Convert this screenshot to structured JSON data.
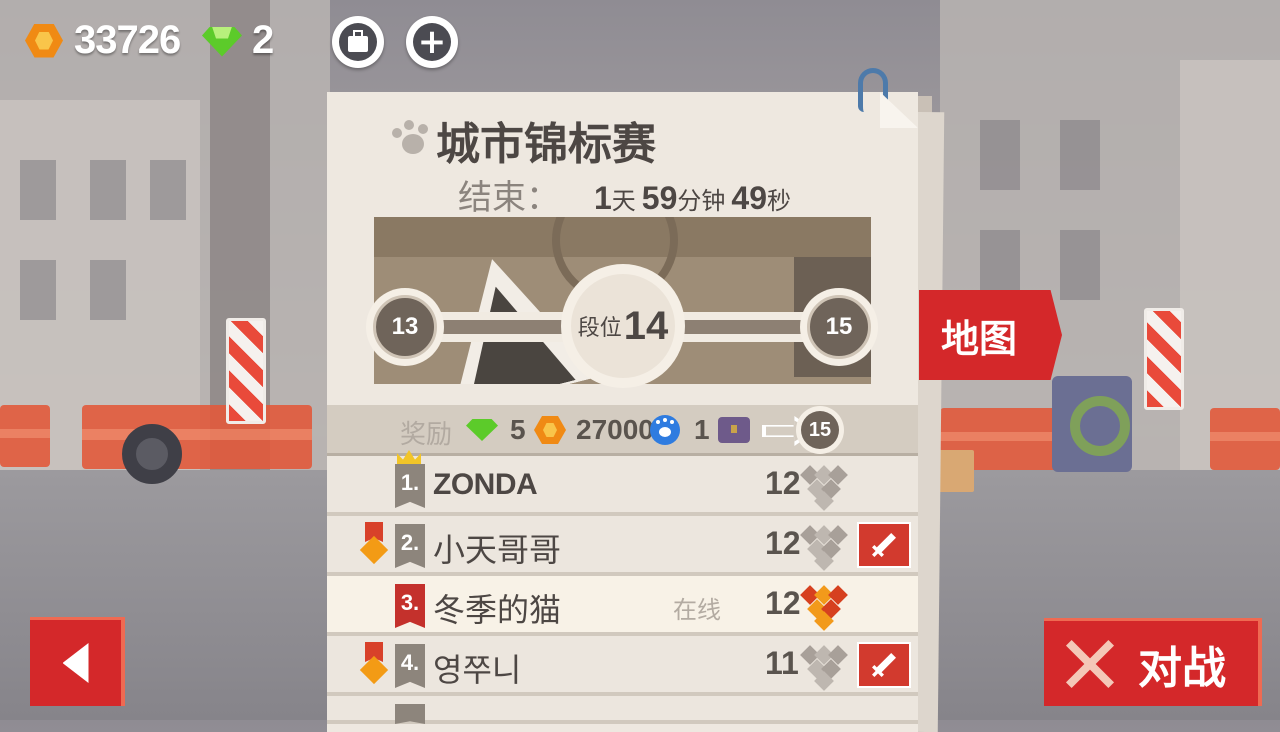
{
  "hud": {
    "coins": "33726",
    "gems": "2",
    "coin_icon": "coin-icon",
    "gem_icon": "gem-icon",
    "bag_icon": "bag-icon",
    "plus_icon": "plus-icon"
  },
  "panel": {
    "title": "城市锦标赛",
    "timer_label": "结束：",
    "timer": {
      "days": "1",
      "days_unit": "天",
      "minutes": "59",
      "minutes_unit": "分钟",
      "seconds": "49",
      "seconds_unit": "秒"
    },
    "progress": {
      "prev_level": "13",
      "current_label": "段位",
      "current_level": "14",
      "next_level": "15"
    },
    "rewards": {
      "label": "奖励",
      "gems": "5",
      "coins": "27000",
      "paws": "1",
      "chests": "1",
      "next_level": "15"
    },
    "leaderboard": [
      {
        "rank": "1.",
        "name": "ZONDA",
        "score": "12",
        "online": "",
        "crown": true,
        "medal": false,
        "attack": false,
        "me": false
      },
      {
        "rank": "2.",
        "name": "小天哥哥",
        "score": "12",
        "online": "",
        "crown": false,
        "medal": true,
        "attack": true,
        "me": false
      },
      {
        "rank": "3.",
        "name": "冬季的猫",
        "score": "12",
        "online": "在线",
        "crown": false,
        "medal": false,
        "attack": false,
        "me": true
      },
      {
        "rank": "4.",
        "name": "영쭈니",
        "score": "11",
        "online": "",
        "crown": false,
        "medal": true,
        "attack": true,
        "me": false
      }
    ]
  },
  "buttons": {
    "map_label": "地图",
    "battle_label": "对战"
  },
  "colors": {
    "accent_red": "#d4282a",
    "panel": "#eee8e0",
    "coin": "#f08a14",
    "gem": "#5ccb2a"
  }
}
